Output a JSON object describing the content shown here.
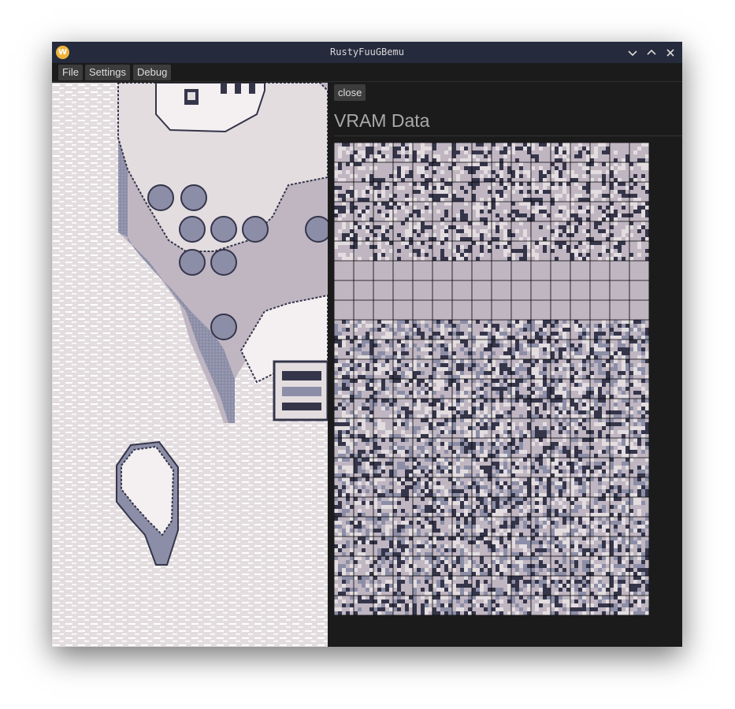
{
  "window": {
    "title": "RustyFuuGBemu",
    "app_icon": "w-logo-icon",
    "controls": [
      "minimize-icon",
      "maximize-icon",
      "close-icon"
    ]
  },
  "menu": {
    "file": "File",
    "settings": "Settings",
    "debug": "Debug"
  },
  "vram_panel": {
    "close_label": "close",
    "heading": "VRAM Data",
    "tile_columns": 16,
    "tile_rows": 24
  },
  "colors": {
    "palette": [
      "#e3dde0",
      "#c0b6c2",
      "#8c8ea7",
      "#35354a"
    ],
    "titlebar": "#252b3d",
    "panel_bg": "#1b1b1b",
    "button_bg": "#3c3c3c",
    "grid_line": "#000000"
  }
}
